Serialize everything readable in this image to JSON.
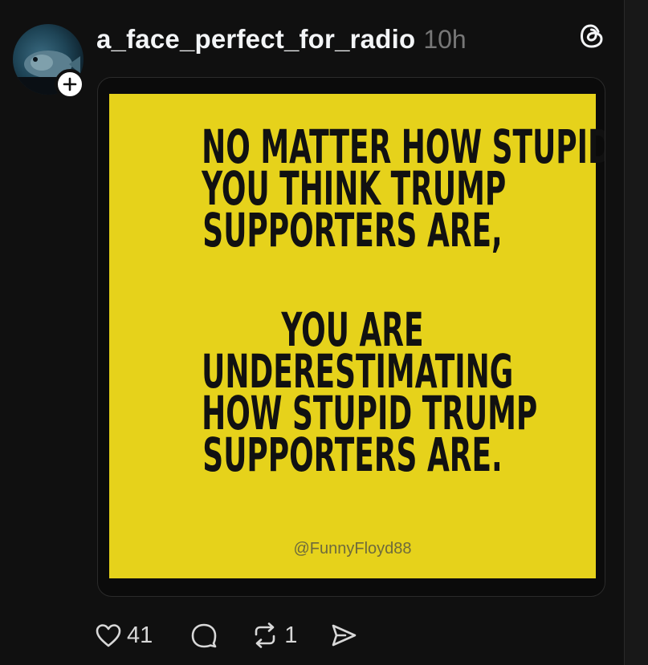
{
  "post": {
    "username": "a_face_perfect_for_radio",
    "time": "10h",
    "avatar_icon": "fish-avatar",
    "follow_icon": "plus-icon",
    "app_icon": "threads-icon"
  },
  "meme": {
    "lines_top": [
      "NO MATTER HOW STUPID",
      "YOU THINK TRUMP",
      "SUPPORTERS ARE,"
    ],
    "lines_bottom": [
      "YOU ARE",
      "UNDERESTIMATING",
      "HOW STUPID TRUMP",
      "SUPPORTERS ARE."
    ],
    "credit": "@FunnyFloyd88",
    "background_color": "#e6d21b"
  },
  "actions": {
    "like_count": "41",
    "repost_count": "1",
    "icons": [
      "heart-icon",
      "comment-icon",
      "repost-icon",
      "share-icon"
    ]
  }
}
